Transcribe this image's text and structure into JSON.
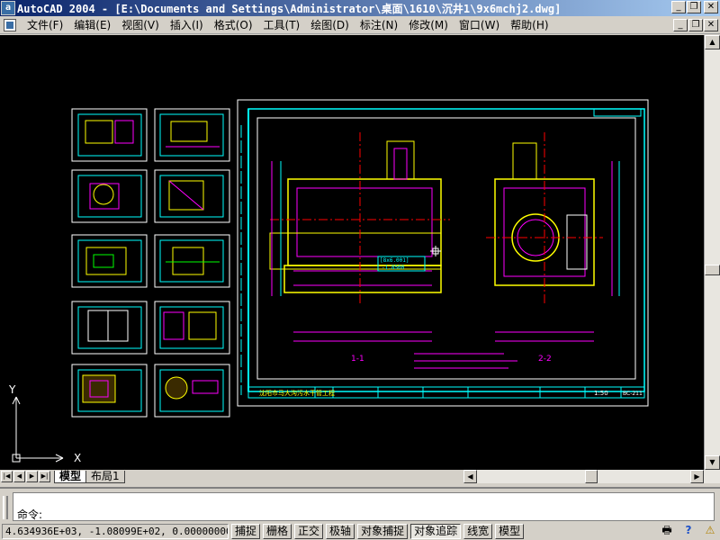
{
  "window": {
    "title": "AutoCAD 2004 - [E:\\Documents and Settings\\Administrator\\桌面\\1610\\沉井1\\9x6mchj2.dwg]",
    "app_icon_letter": "a"
  },
  "menu": {
    "items": [
      "文件(F)",
      "编辑(E)",
      "视图(V)",
      "插入(I)",
      "格式(O)",
      "工具(T)",
      "绘图(D)",
      "标注(N)",
      "修改(M)",
      "窗口(W)",
      "帮助(H)"
    ]
  },
  "drawing": {
    "ucs_y_label": "Y",
    "ucs_x_label": "X",
    "title_block": {
      "project": "沈阳市马大沟污水干管工程",
      "section_left": "1-1",
      "section_right": "2-2",
      "scale": "1:50",
      "drawing_no": "BC-211"
    },
    "annotations": {
      "elev_label": "[8x6.001]",
      "elev_value": "-1.8500"
    }
  },
  "tabs": {
    "nav": [
      "|◀",
      "◀",
      "▶",
      "▶|"
    ],
    "model": "模型",
    "layout1": "布局1"
  },
  "command": {
    "prompt": "命令:"
  },
  "status": {
    "coords": "4.634936E+03, -1.08099E+02, 0.00000000",
    "buttons": [
      {
        "label": "捕捉",
        "on": false
      },
      {
        "label": "栅格",
        "on": false
      },
      {
        "label": "正交",
        "on": false
      },
      {
        "label": "极轴",
        "on": false
      },
      {
        "label": "对象捕捉",
        "on": false
      },
      {
        "label": "对象追踪",
        "on": true
      },
      {
        "label": "线宽",
        "on": false
      },
      {
        "label": "模型",
        "on": false
      }
    ]
  },
  "icons": {
    "status_tray": [
      "printer-icon",
      "help-icon",
      "communication-center-icon"
    ]
  },
  "colors": {
    "canvas": "#000000",
    "cyan": "#00ffff",
    "magenta": "#ff00ff",
    "yellow": "#ffff00",
    "red": "#ff0000",
    "green": "#00ff00",
    "white": "#ffffff"
  }
}
